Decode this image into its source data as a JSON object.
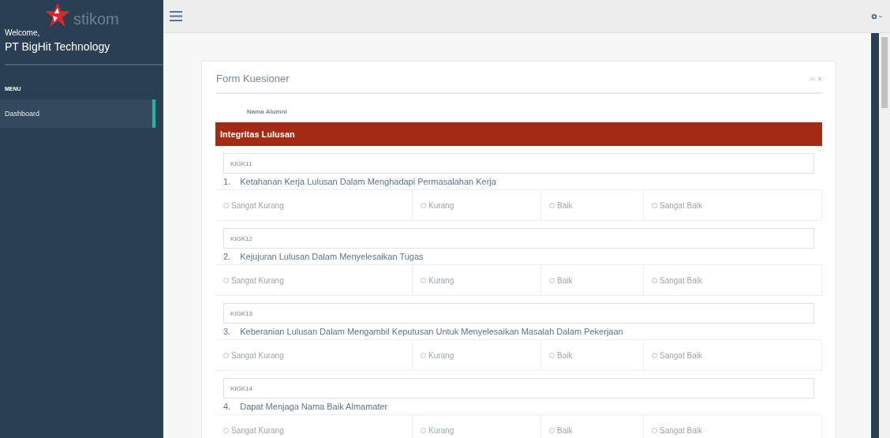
{
  "sidebar": {
    "logo_text": "stikom",
    "welcome": "Welcome,",
    "user": "PT BigHit Technology",
    "menu_title": "MENU",
    "items": [
      {
        "label": "Dashboard",
        "selected": true
      }
    ]
  },
  "panel": {
    "title": "Form Kuesioner",
    "name_label": "Nama Alumni",
    "section": "Integritas Lulusan",
    "questions": [
      {
        "code": "KIGK11",
        "number": "1.",
        "text": "Ketahanan Kerja Lulusan Dalam Menghadapi Permasalahan Kerja",
        "options": [
          {
            "label": "Sangat Kurang",
            "selected": false
          },
          {
            "label": "Kurang",
            "selected": false
          },
          {
            "label": "Baik",
            "selected": false
          },
          {
            "label": "Sangat Baik",
            "selected": false
          }
        ]
      },
      {
        "code": "KIGK12",
        "number": "2.",
        "text": "Kejujuran Lulusan Dalam Menyelesaikan Tugas",
        "options": [
          {
            "label": "Sangat Kurang",
            "selected": false
          },
          {
            "label": "Kurang",
            "selected": false
          },
          {
            "label": "Baik",
            "selected": false
          },
          {
            "label": "Sangat Baik",
            "selected": false
          }
        ]
      },
      {
        "code": "KIGK13",
        "number": "3.",
        "text": "Keberanian Lulusan Dalam Mengambil Keputusan Untuk Menyelesaikan Masalah Dalam Pekerjaan",
        "options": [
          {
            "label": "Sangat Kurang",
            "selected": false
          },
          {
            "label": "Kurang",
            "selected": false
          },
          {
            "label": "Baik",
            "selected": false
          },
          {
            "label": "Sangat Baik",
            "selected": false
          }
        ]
      },
      {
        "code": "KIGK14",
        "number": "4.",
        "text": "Dapat Menjaga Nama Baik Almamater",
        "options": [
          {
            "label": "Sangat Kurang",
            "selected": false
          },
          {
            "label": "Kurang",
            "selected": false
          },
          {
            "label": "Baik",
            "selected": false
          },
          {
            "label": "Sangat Baik",
            "selected": false
          }
        ]
      }
    ]
  }
}
